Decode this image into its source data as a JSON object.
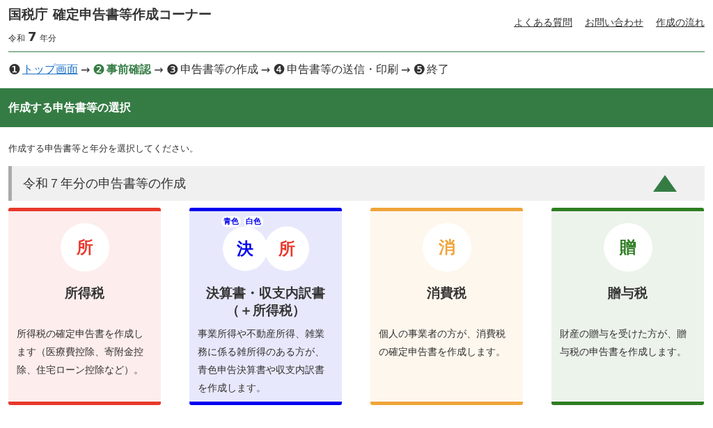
{
  "header": {
    "title": "国税庁 確定申告書等作成コーナー",
    "era": "令和",
    "year": "7",
    "year_suffix": "年分",
    "links": [
      {
        "label": "よくある質問"
      },
      {
        "label": "お問い合わせ"
      },
      {
        "label": "作成の流れ"
      }
    ]
  },
  "steps": [
    {
      "number": "❶",
      "label": "トップ画面",
      "link": true,
      "current": false
    },
    {
      "arrow": "→",
      "number": "❷",
      "label": "事前確認",
      "link": false,
      "current": true
    },
    {
      "arrow": "→",
      "number": "❸",
      "label": "申告書等の作成",
      "link": false,
      "current": false
    },
    {
      "arrow": "→",
      "number": "❹",
      "label": "申告書等の送信・印刷",
      "link": false,
      "current": false
    },
    {
      "arrow": "→",
      "number": "❺",
      "label": "終了",
      "link": false,
      "current": false
    }
  ],
  "banner": {
    "title": "作成する申告書等の選択"
  },
  "instruction": "作成する申告書等と年分を選択してください。",
  "section": {
    "title": "令和７年分の申告書等の作成",
    "expanded": true,
    "cards": [
      {
        "color": "#e8382b",
        "badges": [
          {
            "char": "所",
            "color": "#e8382b"
          }
        ],
        "title": "所得税",
        "description": "所得税の確定申告書を作成します（医療費控除、寄附金控除、住宅ローン控除など）。"
      },
      {
        "color": "#0000ee",
        "tags": [
          "青色",
          "白色"
        ],
        "badges": [
          {
            "char": "決",
            "color": "#0000ee"
          },
          {
            "char": "所",
            "color": "#e8382b"
          }
        ],
        "title": "決算書・収支内訳書（＋所得税）",
        "description": "事業所得や不動産所得、雑業務に係る雑所得のある方が、青色申告決算書や収支内訳書を作成します。"
      },
      {
        "color": "#f0a43a",
        "badges": [
          {
            "char": "消",
            "color": "#f0a43a"
          }
        ],
        "title": "消費税",
        "description": "個人の事業者の方が、消費税の確定申告書を作成します。"
      },
      {
        "color": "#2e7d22",
        "badges": [
          {
            "char": "贈",
            "color": "#2e7d22"
          }
        ],
        "title": "贈与税",
        "description": "財産の贈与を受けた方が、贈与税の申告書を作成します。"
      }
    ]
  }
}
